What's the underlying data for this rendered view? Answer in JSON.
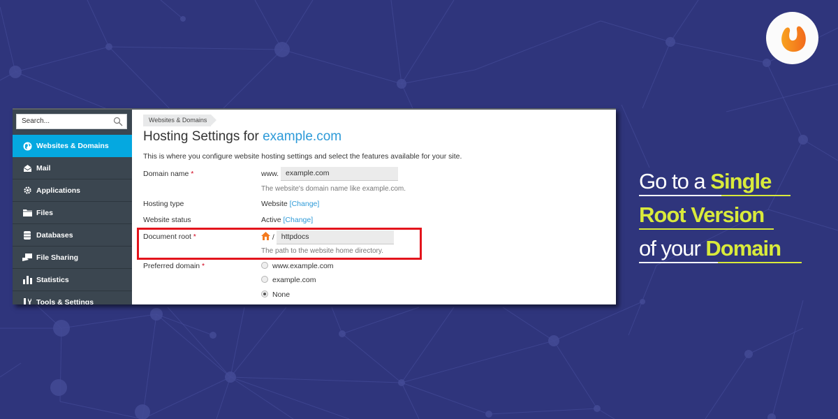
{
  "colors": {
    "background": "#2f357c",
    "sidebar": "#3b4650",
    "sidebar_active": "#05a8e0",
    "link": "#2d9ad8",
    "highlight_box": "#e3141c",
    "headline_accent": "#d9ea3b",
    "logo_orange": "#f7881f"
  },
  "logo": {
    "icon": "brand-logo-icon"
  },
  "sidebar": {
    "search_placeholder": "Search...",
    "items": [
      {
        "label": "Websites & Domains",
        "icon": "globe-icon",
        "active": true
      },
      {
        "label": "Mail",
        "icon": "mail-icon",
        "active": false
      },
      {
        "label": "Applications",
        "icon": "gear-icon",
        "active": false
      },
      {
        "label": "Files",
        "icon": "folder-icon",
        "active": false
      },
      {
        "label": "Databases",
        "icon": "database-icon",
        "active": false
      },
      {
        "label": "File Sharing",
        "icon": "file-sharing-icon",
        "active": false
      },
      {
        "label": "Statistics",
        "icon": "bar-chart-icon",
        "active": false
      },
      {
        "label": "Tools & Settings",
        "icon": "tools-icon",
        "active": false
      }
    ]
  },
  "main": {
    "breadcrumb": "Websites & Domains",
    "title_prefix": "Hosting Settings for ",
    "title_domain": "example.com",
    "intro": "This is where you configure website hosting settings and select the features available for your site.",
    "required_mark": "*",
    "domain_name": {
      "label": "Domain name",
      "prefix": "www.",
      "value": "example.com",
      "hint": "The website's domain name like example.com."
    },
    "hosting_type": {
      "label": "Hosting type",
      "value": "Website",
      "link": "[Change]"
    },
    "website_status": {
      "label": "Website status",
      "value": "Active",
      "link": "[Change]"
    },
    "document_root": {
      "label": "Document root",
      "separator": "/",
      "value": "httpdocs",
      "hint": "The path to the website home directory."
    },
    "preferred_domain": {
      "label": "Preferred domain",
      "options": [
        {
          "label": "www.example.com",
          "selected": false
        },
        {
          "label": "example.com",
          "selected": false
        },
        {
          "label": "None",
          "selected": true
        }
      ]
    }
  },
  "headline": {
    "line1_white": "Go to a ",
    "line1_accent": "Single",
    "line2_accent": "Root Version",
    "line3_white": "of your ",
    "line3_accent": "Domain"
  }
}
